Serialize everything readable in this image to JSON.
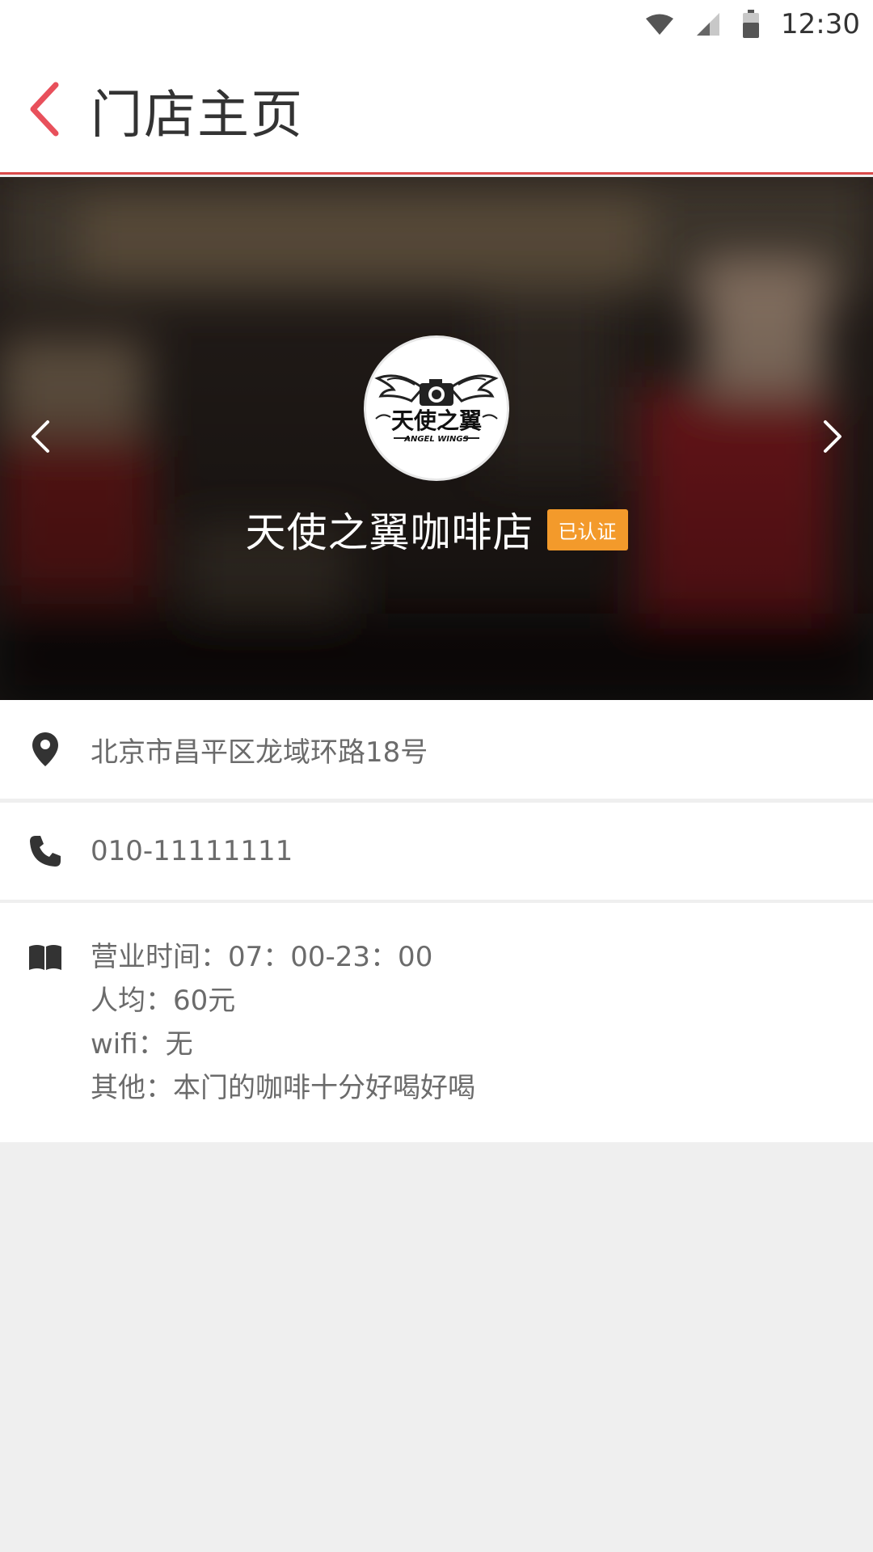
{
  "status_bar": {
    "time": "12:30",
    "icons": [
      "wifi-icon",
      "signal-icon",
      "battery-icon"
    ]
  },
  "header": {
    "back_icon": "chevron-left-icon",
    "title": "门店主页"
  },
  "banner": {
    "logo": {
      "main_text": "天使之翼",
      "sub_text": "ANGEL WINGS"
    },
    "store_name": "天使之翼咖啡店",
    "badge": "已认证",
    "prev_icon": "chevron-left-icon",
    "next_icon": "chevron-right-icon"
  },
  "info": {
    "address": "北京市昌平区龙域环路18号",
    "phone": "010-11111111",
    "details": [
      "营业时间：07：00-23：00",
      "人均：60元",
      "wifi：无",
      "其他：本门的咖啡十分好喝好喝"
    ]
  },
  "colors": {
    "accent": "#e8505b",
    "badge": "#f39a2b",
    "header_divider": "#d94a4a"
  }
}
